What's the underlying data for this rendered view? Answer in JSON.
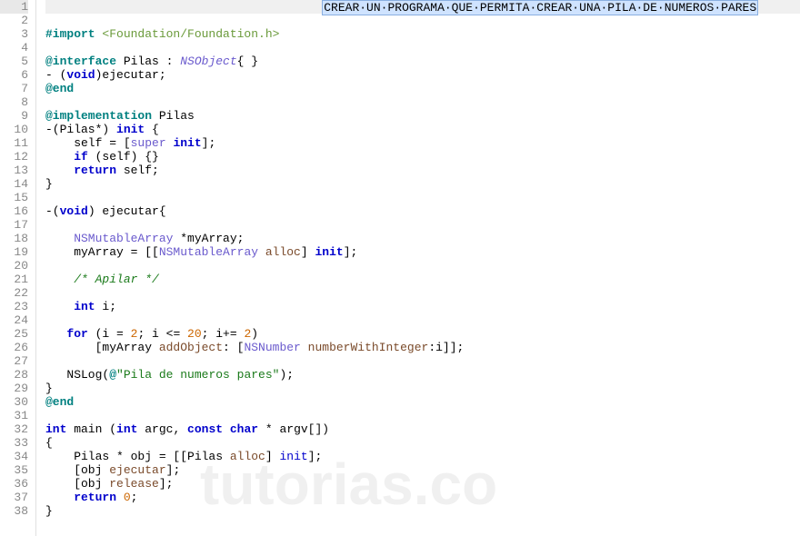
{
  "title_comment": "CREAR·UN·PROGRAMA·QUE·PERMITA·CREAR·UNA·PILA·DE·NUMEROS·PARES",
  "watermark": "tutorias.co",
  "lines": {
    "l3_import": "#import",
    "l3_header": " <Foundation/Foundation.h>",
    "l5_interface": "@interface",
    "l5_name": " Pilas : ",
    "l5_super": "NSObject",
    "l5_braces": "{ }",
    "l6_dash": "- (",
    "l6_void": "void",
    "l6_rest": ")ejecutar;",
    "l7_end": "@end",
    "l9_impl": "@implementation",
    "l9_name": " Pilas",
    "l10_ret": "-(Pilas*) ",
    "l10_init": "init",
    "l10_brace": " {",
    "l11_self": "    self = [",
    "l11_super": "super",
    "l11_init": " init",
    "l11_end": "];",
    "l12_if": "    if",
    "l12_rest": " (self) {}",
    "l13_return": "    return",
    "l13_rest": " self;",
    "l14_brace": "}",
    "l16_dash": "-(",
    "l16_void": "void",
    "l16_rest": ") ejecutar{",
    "l18_cls": "    NSMutableArray",
    "l18_rest": " *myArray;",
    "l19_pre": "    myArray = [[",
    "l19_cls": "NSMutableArray",
    "l19_alloc": " alloc",
    "l19_mid": "] ",
    "l19_init": "init",
    "l19_end": "];",
    "l21_cmt": "    /* Apilar */",
    "l23_int": "    int",
    "l23_rest": " i;",
    "l25_for": "   for",
    "l25_rest": " (i = ",
    "l25_n2": "2",
    "l25_mid1": "; i <= ",
    "l25_n20": "20",
    "l25_mid2": "; i+= ",
    "l25_n2b": "2",
    "l25_end": ")",
    "l26_pre": "       [myArray ",
    "l26_add": "addObject",
    "l26_mid": ": [",
    "l26_cls": "NSNumber",
    "l26_msg": " numberWithInteger",
    "l26_end": ":i]];",
    "l28_pre": "   NSLog(",
    "l28_at": "@",
    "l28_str": "\"Pila de numeros pares\"",
    "l28_end": ");",
    "l29_brace": "}",
    "l30_end": "@end",
    "l32_int": "int",
    "l32_main": " main ",
    "l32_paren": "(",
    "l32_int2": "int",
    "l32_argc": " argc, ",
    "l32_const": "const",
    "l32_char": " char",
    "l32_rest": " * argv[])",
    "l33_brace": "{",
    "l34_pre": "    Pilas * obj = [[Pilas ",
    "l34_alloc": "alloc",
    "l34_mid": "] ",
    "l34_init": "init",
    "l34_end": "];",
    "l35_pre": "    [obj ",
    "l35_msg": "ejecutar",
    "l35_end": "];",
    "l36_pre": "    [obj ",
    "l36_msg": "release",
    "l36_end": "];",
    "l37_return": "    return",
    "l37_num": " 0",
    "l37_end": ";",
    "l38_brace": "}"
  },
  "line_numbers": [
    "1",
    "2",
    "3",
    "4",
    "5",
    "6",
    "7",
    "8",
    "9",
    "10",
    "11",
    "12",
    "13",
    "14",
    "15",
    "16",
    "17",
    "18",
    "19",
    "20",
    "21",
    "22",
    "23",
    "24",
    "25",
    "26",
    "27",
    "28",
    "29",
    "30",
    "31",
    "32",
    "33",
    "34",
    "35",
    "36",
    "37",
    "38"
  ]
}
